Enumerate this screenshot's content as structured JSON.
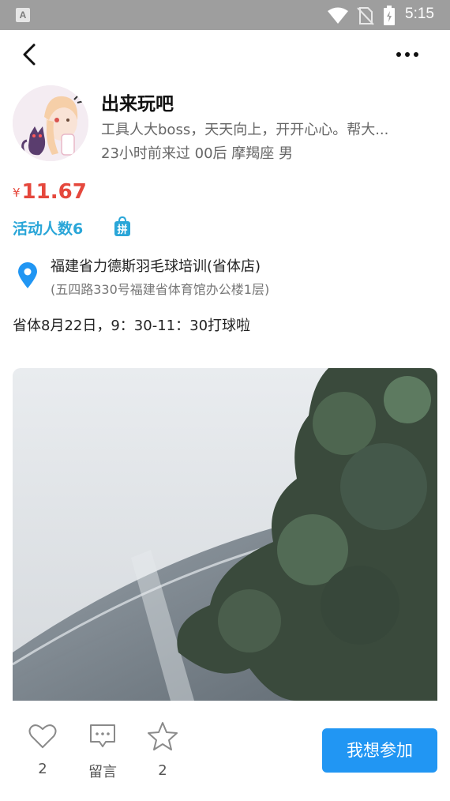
{
  "status_bar": {
    "time": "5:15",
    "app_icon": "A",
    "icons": [
      "app-notification-icon",
      "wifi-icon",
      "no-sim-icon",
      "battery-icon"
    ]
  },
  "nav": {
    "back_icon": "chevron-left-icon",
    "more_icon": "more-icon"
  },
  "user": {
    "name": "出来玩吧",
    "bio": "工具人大boss，天天向上，开开心心。帮大...",
    "meta": "23小时前来过 00后 摩羯座 男"
  },
  "activity": {
    "currency": "¥",
    "price": "11.67",
    "participant_count": "活动人数6",
    "badge_icon": "pin-badge-icon",
    "badge_text": "拼",
    "location_name": "福建省力德斯羽毛球培训(省体店)",
    "location_address": "(五四路330号福建省体育馆办公楼1层)",
    "description": "省体8月22日，9：30-11：30打球啦"
  },
  "actions": {
    "like_count": "2",
    "comment_label": "留言",
    "favorite_count": "2",
    "join_label": "我想参加"
  },
  "colors": {
    "price": "#e5483d",
    "accent": "#2aa6d8",
    "button": "#2196f3",
    "status_bar": "#9e9e9e"
  }
}
